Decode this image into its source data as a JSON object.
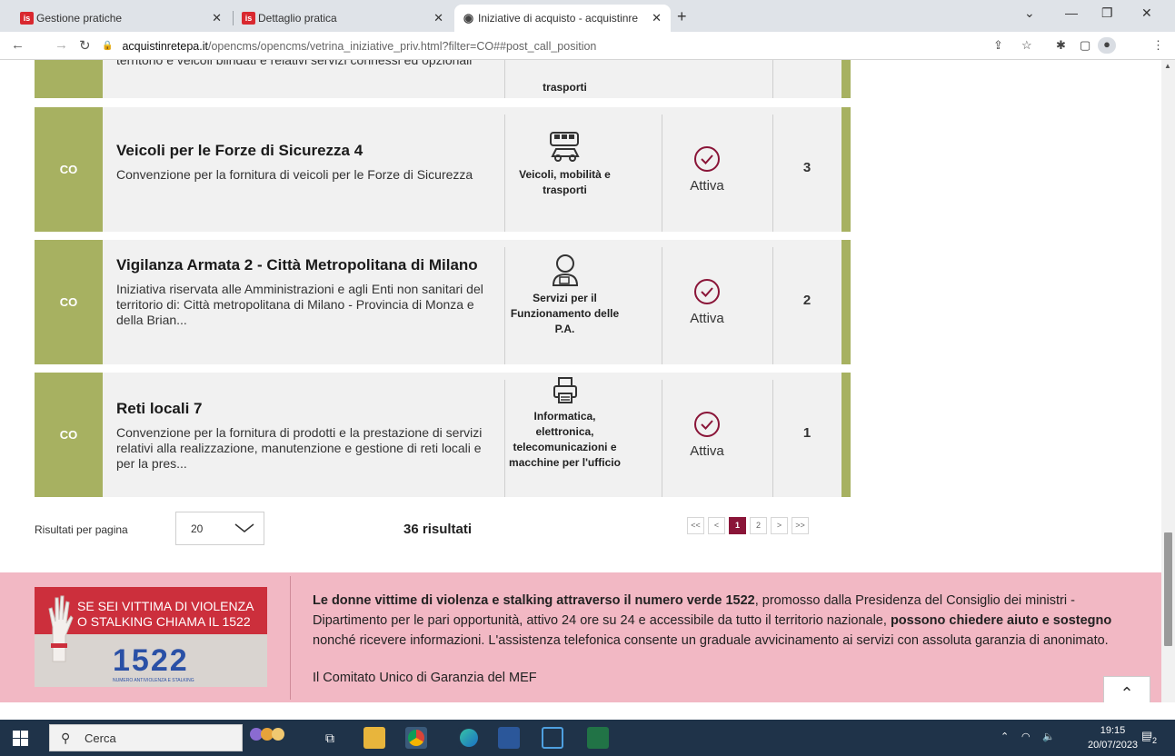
{
  "browser": {
    "tabs": [
      {
        "title": "Gestione pratiche",
        "favicon": "is"
      },
      {
        "title": "Dettaglio pratica",
        "favicon": "is"
      },
      {
        "title": "Iniziative di acquisto - acquistinre",
        "favicon": "globe-icon"
      }
    ],
    "url_domain": "acquistinretepa.it",
    "url_path": "/opencms/opencms/vetrina_iniziative_priv.html?filter=CO##post_call_position"
  },
  "rows": [
    {
      "tag": "",
      "title": "",
      "desc": "territorio e veicoli blindati e relativi servizi connessi ed opzionali",
      "category": "trasporti",
      "status": "",
      "count": ""
    },
    {
      "tag": "CO",
      "title": "Veicoli per le Forze di Sicurezza 4",
      "desc": "Convenzione per la fornitura di veicoli per le Forze di Sicurezza",
      "category": "Veicoli, mobilità e trasporti",
      "status": "Attiva",
      "count": "3"
    },
    {
      "tag": "CO",
      "title": "Vigilanza Armata 2 - Città Metropolitana di Milano",
      "desc": "Iniziativa riservata alle Amministrazioni e agli Enti non sanitari del territorio di: Città metropolitana di Milano - Provincia di Monza e della Brian...",
      "category": "Servizi per il Funzionamento delle P.A.",
      "status": "Attiva",
      "count": "2"
    },
    {
      "tag": "CO",
      "title": "Reti locali 7",
      "desc": "Convenzione per la fornitura di prodotti e la prestazione di servizi relativi alla realizzazione, manutenzione e gestione di reti locali e per la pres...",
      "category": "Informatica, elettronica, telecomunicazioni e macchine per l'ufficio",
      "status": "Attiva",
      "count": "1"
    }
  ],
  "pagination": {
    "per_page_label": "Risultati per pagina",
    "per_page_value": "20",
    "total": "36 risultati",
    "buttons": [
      "<<",
      "<",
      "1",
      "2",
      ">",
      ">>"
    ]
  },
  "banner": {
    "image_text": "SE SEI VITTIMA DI VIOLENZA O STALKING CHIAMA IL 1522",
    "image_number": "1522",
    "image_small": "NUMERO ANTIVIOLENZA E STALKING",
    "msg_bold1": "Le donne vittime di violenza e stalking attraverso il numero verde 1522",
    "msg_part1": ", promosso dalla Presidenza del Consiglio dei ministri - Dipartimento per le pari opportunità, attivo 24 ore su 24 e accessibile da tutto il territorio nazionale, ",
    "msg_bold2": "possono chiedere aiuto e sostegno",
    "msg_part2": " nonché ricevere informazioni. L'assistenza telefonica consente un graduale avvicinamento ai servizi con assoluta garanzia di anonimato.",
    "signature": "Il Comitato Unico di Garanzia del MEF"
  },
  "taskbar": {
    "search_label": "Cerca",
    "time": "19:15",
    "date": "20/07/2023",
    "notif_count": "2"
  },
  "colors": {
    "accent": "#a7b161",
    "row_bg": "#f1f1f1",
    "status": "#8a1538",
    "banner": "#f2b8c4"
  }
}
